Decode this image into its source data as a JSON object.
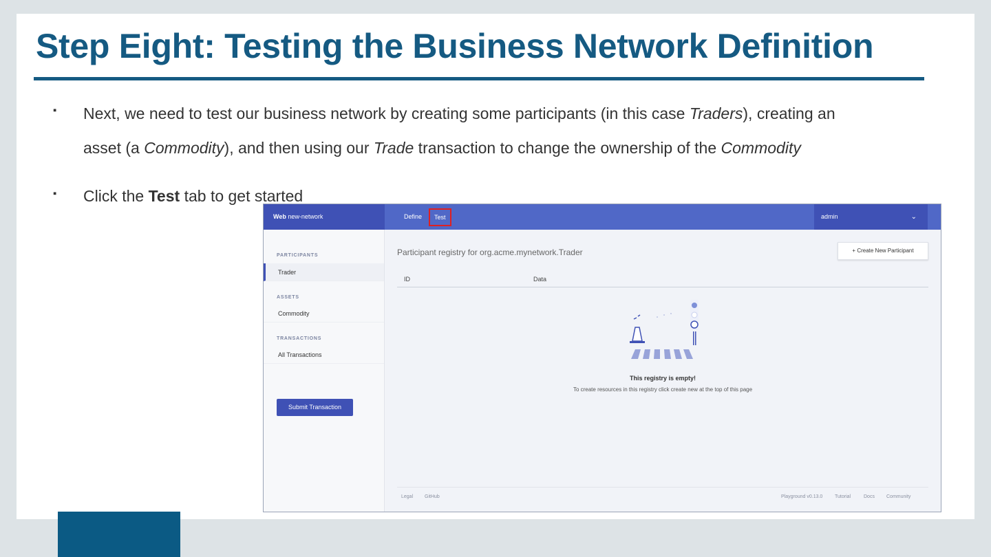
{
  "slide": {
    "title": "Step Eight: Testing the Business Network Definition",
    "bullet_marker": "▪",
    "bullet1": {
      "line1_a": "Next, we need to test our business network by creating some participants (in this case ",
      "line1_italic": "Traders",
      "line1_b": "), creating an",
      "line2_a": "asset (a ",
      "line2_italic1": "Commodity",
      "line2_b": "), and then using our ",
      "line2_italic2": "Trade",
      "line2_c": " transaction to change the ownership of the ",
      "line2_italic3": "Commodity"
    },
    "bullet2": {
      "a": "Click the ",
      "bold": "Test",
      "b": " tab to get started"
    },
    "colors": {
      "title": "#155a82",
      "accent_block": "#0b5a84",
      "app_header": "#5068c7",
      "primary_button": "#3f51b5",
      "highlight": "#e02020"
    }
  },
  "app": {
    "brand_bold": "Web",
    "brand_rest": " new-network",
    "tabs": [
      "Define",
      "Test"
    ],
    "user": "admin",
    "user_chevron": "chevron-down-icon",
    "sidebar": {
      "sections": [
        {
          "heading": "PARTICIPANTS",
          "items": [
            "Trader"
          ]
        },
        {
          "heading": "ASSETS",
          "items": [
            "Commodity"
          ]
        },
        {
          "heading": "TRANSACTIONS",
          "items": [
            "All Transactions"
          ]
        }
      ],
      "submit_label": "Submit Transaction"
    },
    "main": {
      "registry_title": "Participant registry for org.acme.mynetwork.Trader",
      "create_label": "+ Create New Participant",
      "columns": [
        "ID",
        "Data"
      ],
      "empty_title": "This registry is empty!",
      "empty_sub": "To create resources in this registry click create new at the top of this page"
    },
    "footer": {
      "left": [
        "Legal",
        "GitHub"
      ],
      "right": [
        "Playground v0.13.0",
        "Tutorial",
        "Docs",
        "Community"
      ]
    }
  }
}
